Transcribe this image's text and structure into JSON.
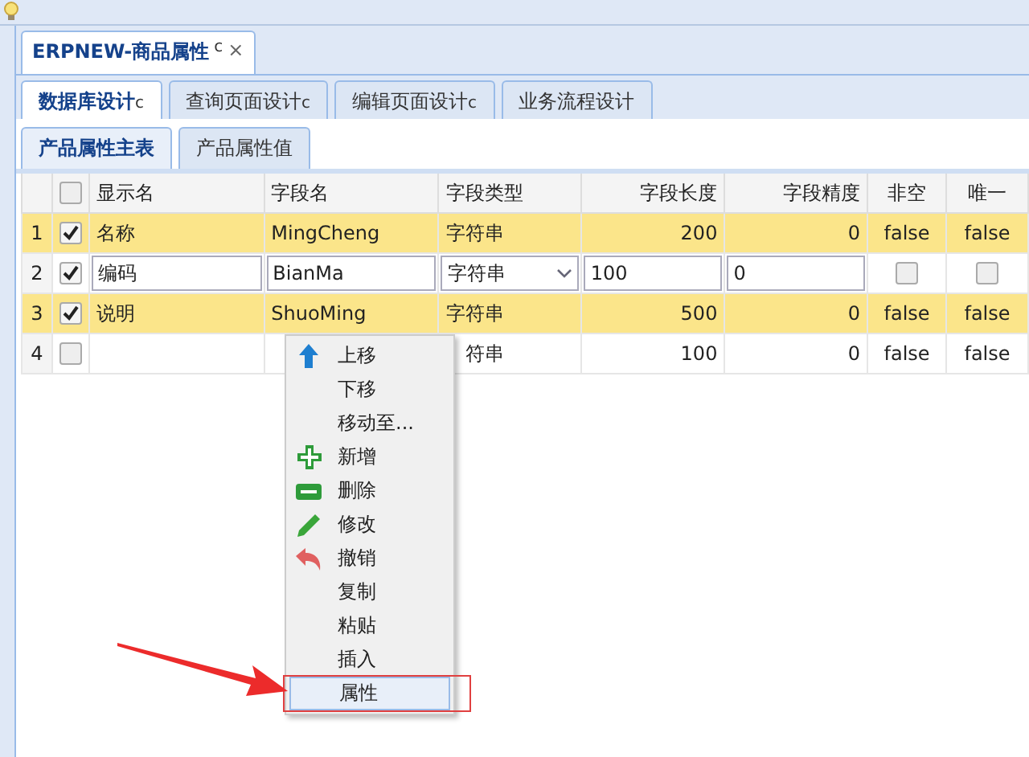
{
  "doc_tab": {
    "title": "ERPNEW-商品属性",
    "refresh": "c",
    "close": "×"
  },
  "tabs": [
    {
      "label": "数据库设计",
      "refresh": "c",
      "selected": true
    },
    {
      "label": "查询页面设计",
      "refresh": "c",
      "selected": false
    },
    {
      "label": "编辑页面设计",
      "refresh": "c",
      "selected": false
    },
    {
      "label": "业务流程设计",
      "selected": false
    }
  ],
  "sub_tabs": [
    {
      "label": "产品属性主表",
      "selected": true
    },
    {
      "label": "产品属性值",
      "selected": false
    }
  ],
  "table": {
    "all_checked": false,
    "columns": [
      "显示名",
      "字段名",
      "字段类型",
      "字段长度",
      "字段精度",
      "非空",
      "唯一"
    ],
    "rows": [
      {
        "kind": "view",
        "num": "1",
        "checked": true,
        "selected": true,
        "cells": [
          "名称",
          "MingCheng",
          "字符串",
          "200",
          "0",
          "false",
          "false"
        ]
      },
      {
        "kind": "edit",
        "num": "2",
        "checked": true,
        "selected": false,
        "cells": [
          "编码",
          "BianMa",
          "字符串",
          "100",
          "0"
        ],
        "not_null": false,
        "unique": false
      },
      {
        "kind": "view",
        "num": "3",
        "checked": true,
        "selected": true,
        "cells": [
          "说明",
          "ShuoMing",
          "字符串",
          "500",
          "0",
          "false",
          "false"
        ]
      },
      {
        "kind": "view",
        "num": "4",
        "checked": false,
        "selected": false,
        "cells": [
          "",
          "",
          "符串",
          "100",
          "0",
          "false",
          "false"
        ]
      }
    ]
  },
  "context_menu": [
    {
      "label": "上移",
      "kind": "up",
      "selected": false
    },
    {
      "label": "下移",
      "selected": false
    },
    {
      "label": "移动至...",
      "selected": false
    },
    {
      "label": "新增",
      "kind": "add",
      "selected": false
    },
    {
      "label": "删除",
      "kind": "remove",
      "selected": false
    },
    {
      "label": "修改",
      "kind": "edit",
      "selected": false
    },
    {
      "label": "撤销",
      "kind": "undo",
      "selected": false
    },
    {
      "label": "复制",
      "selected": false
    },
    {
      "label": "粘贴",
      "selected": false
    },
    {
      "label": "插入",
      "selected": false
    },
    {
      "label": "属性",
      "selected": true
    }
  ]
}
